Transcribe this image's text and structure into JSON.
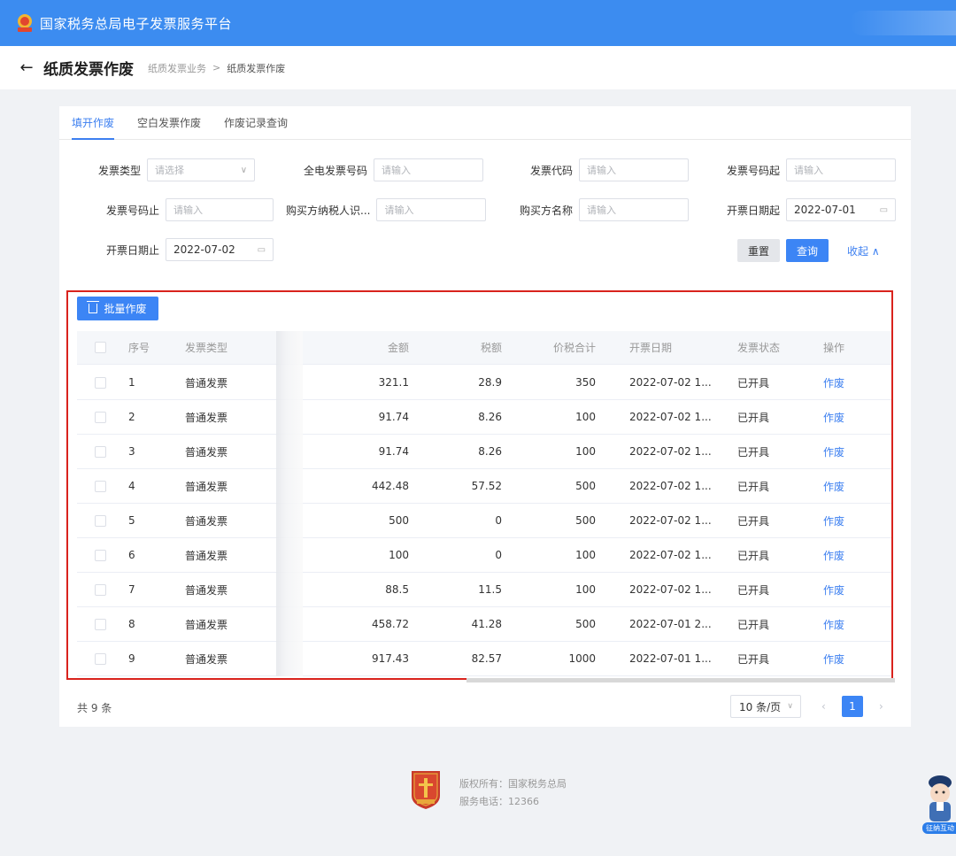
{
  "app": {
    "title": "国家税务总局电子发票服务平台"
  },
  "page": {
    "title": "纸质发票作废",
    "breadcrumb": [
      "纸质发票业务",
      "纸质发票作废"
    ],
    "breadcrumb_sep": ">"
  },
  "tabs": [
    {
      "label": "填开作废",
      "active": true
    },
    {
      "label": "空白发票作废",
      "active": false
    },
    {
      "label": "作废记录查询",
      "active": false
    }
  ],
  "form": {
    "invoice_type": {
      "label": "发票类型",
      "placeholder": "请选择"
    },
    "full_elec_no": {
      "label": "全电发票号码",
      "placeholder": "请输入"
    },
    "invoice_code": {
      "label": "发票代码",
      "placeholder": "请输入"
    },
    "no_from": {
      "label": "发票号码起",
      "placeholder": "请输入"
    },
    "no_to": {
      "label": "发票号码止",
      "placeholder": "请输入"
    },
    "buyer_taxid": {
      "label": "购买方纳税人识...",
      "placeholder": "请输入"
    },
    "buyer_name": {
      "label": "购买方名称",
      "placeholder": "请输入"
    },
    "date_from": {
      "label": "开票日期起",
      "value": "2022-07-01"
    },
    "date_to": {
      "label": "开票日期止",
      "value": "2022-07-02"
    },
    "reset_label": "重置",
    "query_label": "查询",
    "collapse_label": "收起 ∧"
  },
  "table": {
    "batch_label": "批量作废",
    "headers": [
      "序号",
      "发票类型",
      "金额",
      "税额",
      "价税合计",
      "开票日期",
      "发票状态",
      "操作"
    ],
    "rows": [
      {
        "no": "1",
        "type": "普通发票",
        "amount": "321.1",
        "tax": "28.9",
        "total": "350",
        "date": "2022-07-02 1...",
        "status": "已开具",
        "op": "作废"
      },
      {
        "no": "2",
        "type": "普通发票",
        "amount": "91.74",
        "tax": "8.26",
        "total": "100",
        "date": "2022-07-02 1...",
        "status": "已开具",
        "op": "作废"
      },
      {
        "no": "3",
        "type": "普通发票",
        "amount": "91.74",
        "tax": "8.26",
        "total": "100",
        "date": "2022-07-02 1...",
        "status": "已开具",
        "op": "作废"
      },
      {
        "no": "4",
        "type": "普通发票",
        "amount": "442.48",
        "tax": "57.52",
        "total": "500",
        "date": "2022-07-02 1...",
        "status": "已开具",
        "op": "作废"
      },
      {
        "no": "5",
        "type": "普通发票",
        "amount": "500",
        "tax": "0",
        "total": "500",
        "date": "2022-07-02 1...",
        "status": "已开具",
        "op": "作废"
      },
      {
        "no": "6",
        "type": "普通发票",
        "amount": "100",
        "tax": "0",
        "total": "100",
        "date": "2022-07-02 1...",
        "status": "已开具",
        "op": "作废"
      },
      {
        "no": "7",
        "type": "普通发票",
        "amount": "88.5",
        "tax": "11.5",
        "total": "100",
        "date": "2022-07-02 1...",
        "status": "已开具",
        "op": "作废"
      },
      {
        "no": "8",
        "type": "普通发票",
        "amount": "458.72",
        "tax": "41.28",
        "total": "500",
        "date": "2022-07-01 2...",
        "status": "已开具",
        "op": "作废"
      },
      {
        "no": "9",
        "type": "普通发票",
        "amount": "917.43",
        "tax": "82.57",
        "total": "1000",
        "date": "2022-07-01 1...",
        "status": "已开具",
        "op": "作废"
      }
    ]
  },
  "pagination": {
    "total_text": "共 9 条",
    "page_size": "10 条/页",
    "current_page": "1",
    "prev": "‹",
    "next": "›"
  },
  "footer": {
    "copyright": "版权所有：国家税务总局",
    "hotline": "服务电话：12366"
  },
  "assistant": {
    "label": "征纳互动"
  },
  "colors": {
    "primary": "#3c85f5",
    "topbar": "#3c8cf0",
    "highlight_border": "#d9231d"
  }
}
